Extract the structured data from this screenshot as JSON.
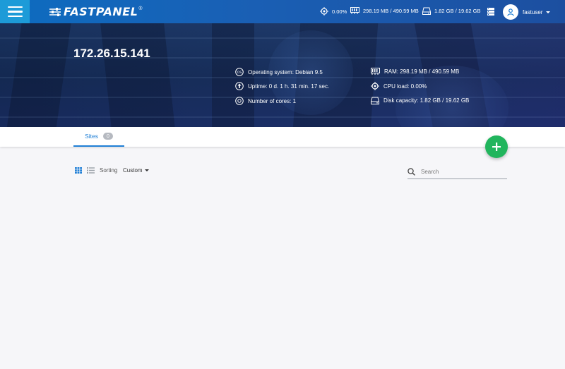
{
  "brand": {
    "name": "FASTPANEL",
    "reg": "®"
  },
  "header": {
    "cpu": "0.00%",
    "ram": "298.19 MB / 490.59 MB",
    "disk": "1.82 GB / 19.62 GB",
    "user": "fastuser"
  },
  "server": {
    "ip": "172.26.15.141",
    "os": "Operating system: Debian 9.5",
    "uptime": "Uptime: 0 d. 1 h. 31 min. 17 sec.",
    "cores": "Number of cores: 1",
    "ram": "RAM: 298.19 MB / 490.59 MB",
    "cpu": "CPU load: 0.00%",
    "disk": "Disk capacity: 1.82 GB / 19.62 GB"
  },
  "tabs": [
    {
      "label": "Sites",
      "count": "0"
    }
  ],
  "toolbar": {
    "sort_label": "Sorting",
    "sort_value": "Custom",
    "search_placeholder": "Search"
  },
  "colors": {
    "accent": "#1f7fd6",
    "fab": "#21b55d",
    "topbar": "#1a5fb4"
  }
}
